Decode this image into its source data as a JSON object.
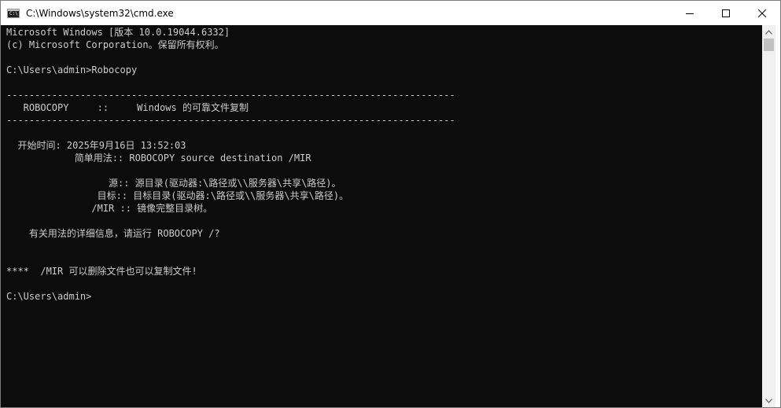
{
  "window": {
    "title": "C:\\Windows\\system32\\cmd.exe",
    "icon": "cmd-icon",
    "icon_glyph": "C:\\"
  },
  "controls": {
    "minimize": "minimize-icon",
    "maximize": "maximize-icon",
    "close": "close-icon"
  },
  "console": {
    "lines": [
      "Microsoft Windows [版本 10.0.19044.6332]",
      "(c) Microsoft Corporation。保留所有权利。",
      "",
      "C:\\Users\\admin>Robocopy",
      "",
      "-------------------------------------------------------------------------------",
      "   ROBOCOPY     ::     Windows 的可靠文件复制",
      "-------------------------------------------------------------------------------",
      "",
      "  开始时间: 2025年9月16日 13:52:03",
      "            简单用法:: ROBOCOPY source destination /MIR",
      "",
      "                  源:: 源目录(驱动器:\\路径或\\\\服务器\\共享\\路径)。",
      "                目标:: 目标目录(驱动器:\\路径或\\\\服务器\\共享\\路径)。",
      "               /MIR :: 镜像完整目录树。",
      "",
      "    有关用法的详细信息，请运行 ROBOCOPY /?",
      "",
      "",
      "****  /MIR 可以删除文件也可以复制文件!",
      "",
      "C:\\Users\\admin>"
    ]
  },
  "scrollbar": {
    "up": "scroll-up-arrow-icon",
    "down": "scroll-down-arrow-icon"
  }
}
